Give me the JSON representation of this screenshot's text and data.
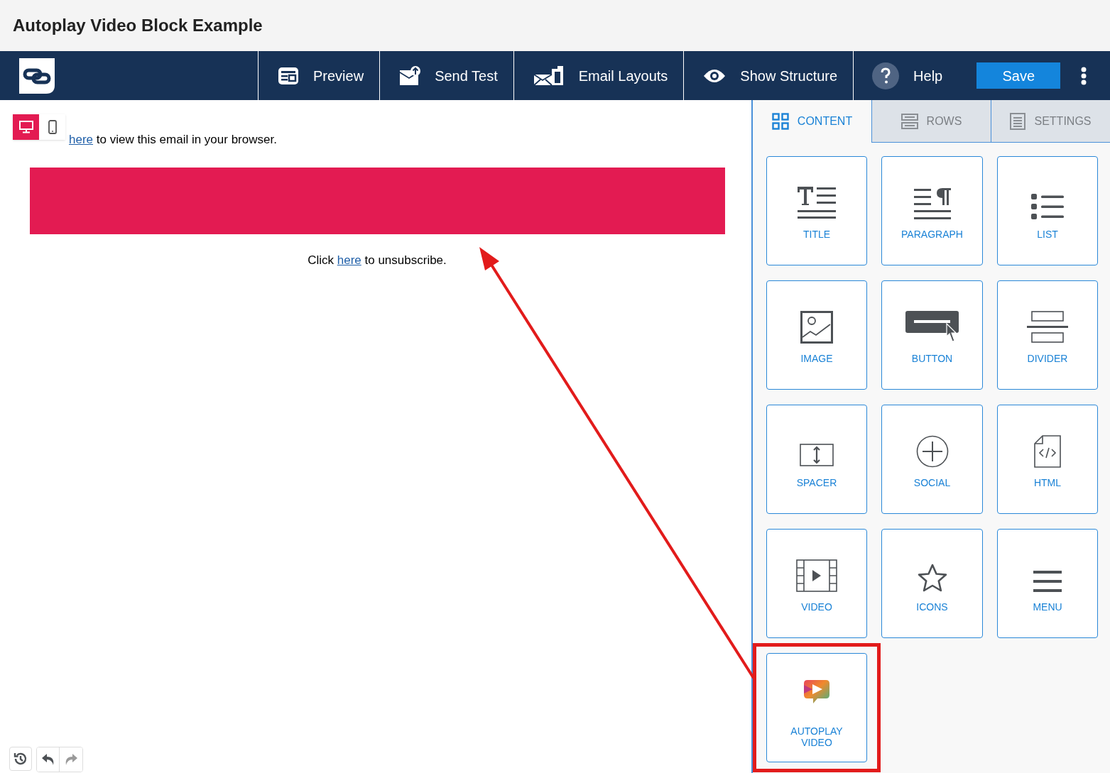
{
  "page_title": "Autoplay Video Block Example",
  "toolbar": [
    {
      "kind": "preview",
      "label": "Preview"
    },
    {
      "kind": "send",
      "label": "Send Test"
    },
    {
      "kind": "layouts",
      "label": "Email Layouts"
    },
    {
      "kind": "structure",
      "label": "Show Structure"
    },
    {
      "kind": "help",
      "label": "Help"
    }
  ],
  "save_button": "Save",
  "device_toggle": [
    {
      "kind": "desktop",
      "selected": true
    },
    {
      "kind": "mobile",
      "selected": false
    }
  ],
  "email": {
    "header_line": {
      "link": "here",
      "after": " to view this email in your browser."
    },
    "footer_line": {
      "before": "Click ",
      "link": "here",
      "after": " to unsubscribe."
    }
  },
  "panel_tabs": [
    {
      "kind": "content",
      "label": "CONTENT",
      "selected": true
    },
    {
      "kind": "rows",
      "label": "ROWS",
      "selected": false
    },
    {
      "kind": "settings",
      "label": "SETTINGS",
      "selected": false
    }
  ],
  "blocks": [
    {
      "kind": "title",
      "label": "TITLE"
    },
    {
      "kind": "paragraph",
      "label": "PARAGRAPH"
    },
    {
      "kind": "list",
      "label": "LIST"
    },
    {
      "kind": "image",
      "label": "IMAGE"
    },
    {
      "kind": "button",
      "label": "BUTTON"
    },
    {
      "kind": "divider",
      "label": "DIVIDER"
    },
    {
      "kind": "spacer",
      "label": "SPACER"
    },
    {
      "kind": "social",
      "label": "SOCIAL"
    },
    {
      "kind": "html",
      "label": "HTML"
    },
    {
      "kind": "video",
      "label": "VIDEO"
    },
    {
      "kind": "icons",
      "label": "ICONS"
    },
    {
      "kind": "menu",
      "label": "MENU"
    },
    {
      "kind": "autoplay",
      "label": "AUTOPLAY VIDEO"
    }
  ],
  "history_controls": [
    {
      "kind": "history",
      "disabled": false
    },
    {
      "kind": "undo",
      "disabled": false
    },
    {
      "kind": "redo",
      "disabled": true
    }
  ],
  "annotations": {
    "highlight_frame": true,
    "arrow": true
  }
}
